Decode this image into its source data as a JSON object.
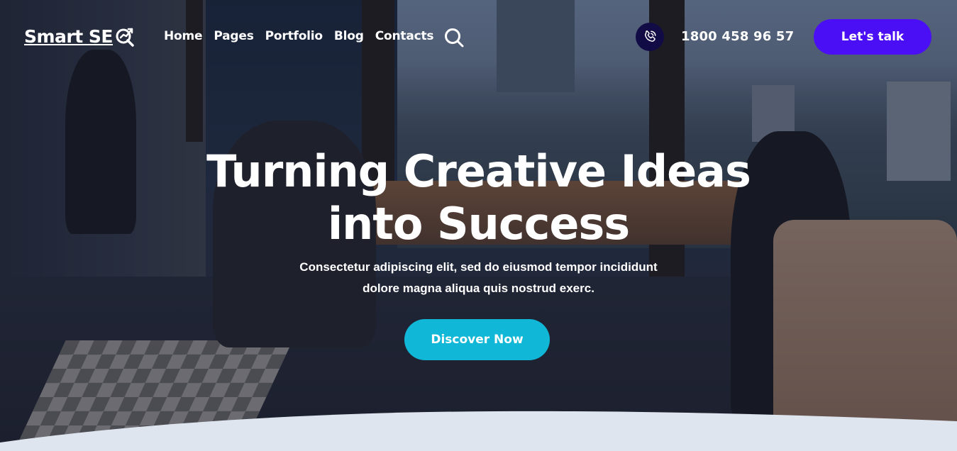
{
  "colors": {
    "accent_purple": "#4a0ff5",
    "accent_cyan": "#10b7d6",
    "phone_circle": "#120c46",
    "wave": "#dfe5ee"
  },
  "brand": {
    "logo_text": "Smart SE",
    "logo_icon": "magnifier-arrow-icon"
  },
  "nav": {
    "items": [
      {
        "label": "Home"
      },
      {
        "label": "Pages"
      },
      {
        "label": "Portfolio"
      },
      {
        "label": "Blog"
      },
      {
        "label": "Contacts"
      }
    ],
    "search_icon": "search-icon"
  },
  "contact": {
    "phone_icon": "phone-icon",
    "phone_number": "1800 458 96 57"
  },
  "header_cta": {
    "label": "Let's talk"
  },
  "hero": {
    "title_line1": "Turning Creative Ideas",
    "title_line2": "into Success",
    "subtitle_line1": "Consectetur adipiscing elit, sed do eiusmod tempor incididunt",
    "subtitle_line2": "dolore magna aliqua quis nostrud exerc.",
    "button_label": "Discover Now"
  }
}
